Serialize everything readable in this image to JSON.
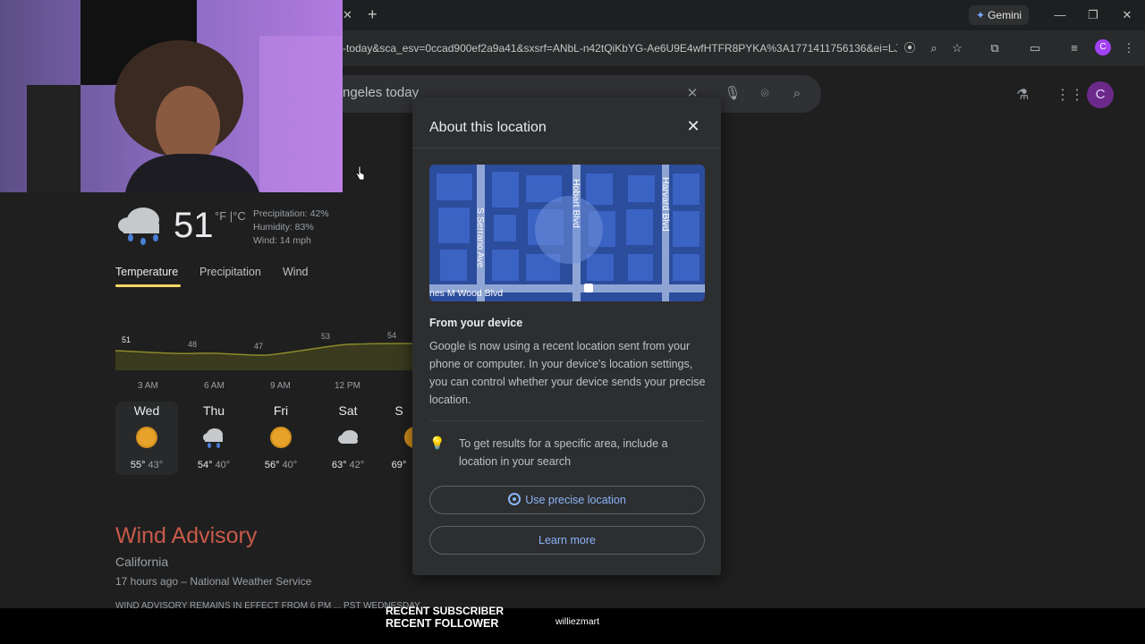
{
  "browser": {
    "tab_close": "✕",
    "new_tab": "+",
    "gemini_label": "Gemini",
    "url": "-today&sca_esv=0ccad900ef2a9a41&sxsrf=ANbL-n42tQiKbYG-Ae6U9E4wfHTFR8PYKA%3A1771411756136&ei=LJmVa...",
    "profile_initial": "C",
    "icons": [
      "location-icon",
      "zoom-icon",
      "bookmark-star-icon",
      "extensions-icon",
      "cast-icon",
      "media-icon",
      "profile-icon",
      "menu-icon"
    ]
  },
  "search": {
    "query": "ngeles today",
    "avatar_initial": "C"
  },
  "weather": {
    "temperature": "51",
    "unit_f": "°F",
    "unit_sep": "|",
    "unit_c": "°C",
    "precipitation": "Precipitation: 42%",
    "humidity": "Humidity: 83%",
    "wind": "Wind: 14 mph",
    "tabs": [
      "Temperature",
      "Precipitation",
      "Wind"
    ],
    "hourly_values": [
      "51",
      "48",
      "47",
      "53",
      "54"
    ],
    "hourly_times": [
      "3 AM",
      "6 AM",
      "9 AM",
      "12 PM"
    ],
    "days": [
      {
        "name": "Wed",
        "hi": "55°",
        "lo": "43°",
        "icon": "sunny-icon"
      },
      {
        "name": "Thu",
        "hi": "54°",
        "lo": "40°",
        "icon": "rain-icon"
      },
      {
        "name": "Fri",
        "hi": "56°",
        "lo": "40°",
        "icon": "sunny-icon"
      },
      {
        "name": "Sat",
        "hi": "63°",
        "lo": "42°",
        "icon": "cloudy-icon"
      },
      {
        "name": "S",
        "hi": "69°",
        "lo": "",
        "icon": "sunny-icon"
      }
    ]
  },
  "advisory": {
    "title": "Wind Advisory",
    "region": "California",
    "time": "17 hours ago – National Weather Service",
    "snippet": "WIND ADVISORY REMAINS IN EFFECT FROM 6 PM ... PST WEDNESDAY ..."
  },
  "dialog": {
    "title": "About this location",
    "map_labels": {
      "street1": "S Serrano Ave",
      "street2": "Hobart Blvd",
      "street3": "Harvard Blvd",
      "street4": "nes M Wood Blvd"
    },
    "from_device": "From your device",
    "body": "Google is now using a recent location sent from your phone or computer. In your device's location settings, you can control whether your device sends your precise location.",
    "tip": "To get results for a specific area, include a location in your search",
    "btn_precise": "Use precise location",
    "btn_learn": "Learn more"
  },
  "stream": {
    "recent_subscriber": "RECENT SUBSCRIBER",
    "recent_follower": "RECENT FOLLOWER",
    "follower_name": "williezmart"
  },
  "colors": {
    "accent_blue": "#8ab4f8",
    "tab_underline": "#fdd663",
    "advisory_red": "#c85a4a",
    "avatar_purple": "#a142f4"
  }
}
